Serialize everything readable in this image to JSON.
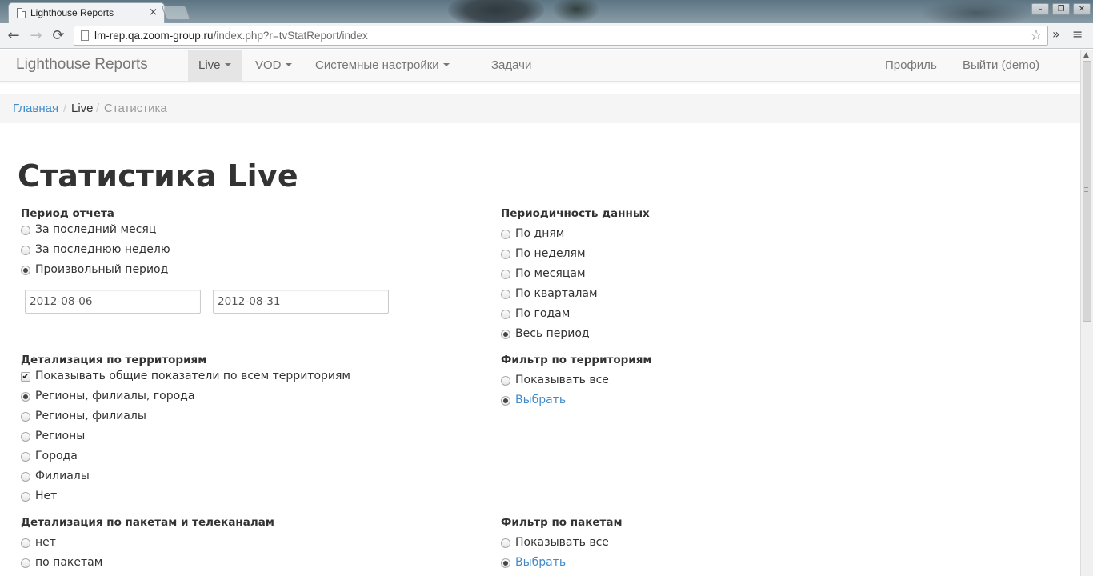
{
  "browser": {
    "tab_title": "Lighthouse Reports",
    "tab_close": "×",
    "url_host": "lm-rep.qa.zoom-group.ru",
    "url_path": "/index.php?r=tvStatReport/index",
    "back": "←",
    "forward": "→",
    "reload": "⟳",
    "star": "☆",
    "extensions": "»",
    "menu": "≡",
    "window_controls": [
      "–",
      "❐",
      "✕"
    ]
  },
  "navbar": {
    "brand": "Lighthouse Reports",
    "items": [
      {
        "label": "Live",
        "dropdown": true,
        "active": true
      },
      {
        "label": "VOD",
        "dropdown": true,
        "active": false
      },
      {
        "label": "Системные настройки",
        "dropdown": true,
        "active": false
      },
      {
        "label": "Задачи",
        "dropdown": false,
        "active": false
      }
    ],
    "right": [
      {
        "label": "Профиль"
      },
      {
        "label": "Выйти (demo)"
      }
    ]
  },
  "breadcrumb": {
    "home": "Главная",
    "separator": "/",
    "section": "Live",
    "current": "Статистика"
  },
  "page_title": "Статистика Live",
  "report_period": {
    "label": "Период отчета",
    "options": [
      {
        "label": "За последний месяц",
        "checked": false
      },
      {
        "label": "За последнюю неделю",
        "checked": false
      },
      {
        "label": "Произвольный период",
        "checked": true
      }
    ],
    "date_from": "2012-08-06",
    "date_to": "2012-08-31"
  },
  "data_frequency": {
    "label": "Периодичность данных",
    "options": [
      {
        "label": "По дням",
        "checked": false
      },
      {
        "label": "По неделям",
        "checked": false
      },
      {
        "label": "По месяцам",
        "checked": false
      },
      {
        "label": "По кварталам",
        "checked": false
      },
      {
        "label": "По годам",
        "checked": false
      },
      {
        "label": "Весь период",
        "checked": true
      }
    ]
  },
  "territory_detail": {
    "label": "Детализация по территориям",
    "show_totals": {
      "label": "Показывать общие показатели по всем территориям",
      "checked": true
    },
    "options": [
      {
        "label": "Регионы, филиалы, города",
        "checked": true
      },
      {
        "label": "Регионы, филиалы",
        "checked": false
      },
      {
        "label": "Регионы",
        "checked": false
      },
      {
        "label": "Города",
        "checked": false
      },
      {
        "label": "Филиалы",
        "checked": false
      },
      {
        "label": "Нет",
        "checked": false
      }
    ]
  },
  "territory_filter": {
    "label": "Фильтр по территориям",
    "options": [
      {
        "label": "Показывать все",
        "checked": false
      },
      {
        "label": "Выбрать",
        "checked": true,
        "link": true
      }
    ]
  },
  "package_detail": {
    "label": "Детализация по пакетам и телеканалам",
    "options": [
      {
        "label": "нет",
        "checked": false
      },
      {
        "label": "по пакетам",
        "checked": false
      }
    ]
  },
  "package_filter": {
    "label": "Фильтр по пакетам",
    "options": [
      {
        "label": "Показывать все",
        "checked": false
      },
      {
        "label": "Выбрать",
        "checked": true,
        "link": true
      }
    ]
  },
  "colors": {
    "link": "#428bca",
    "navbar_bg": "#f8f8f8",
    "active_nav_bg": "#e5e5e5",
    "text": "#333333"
  }
}
